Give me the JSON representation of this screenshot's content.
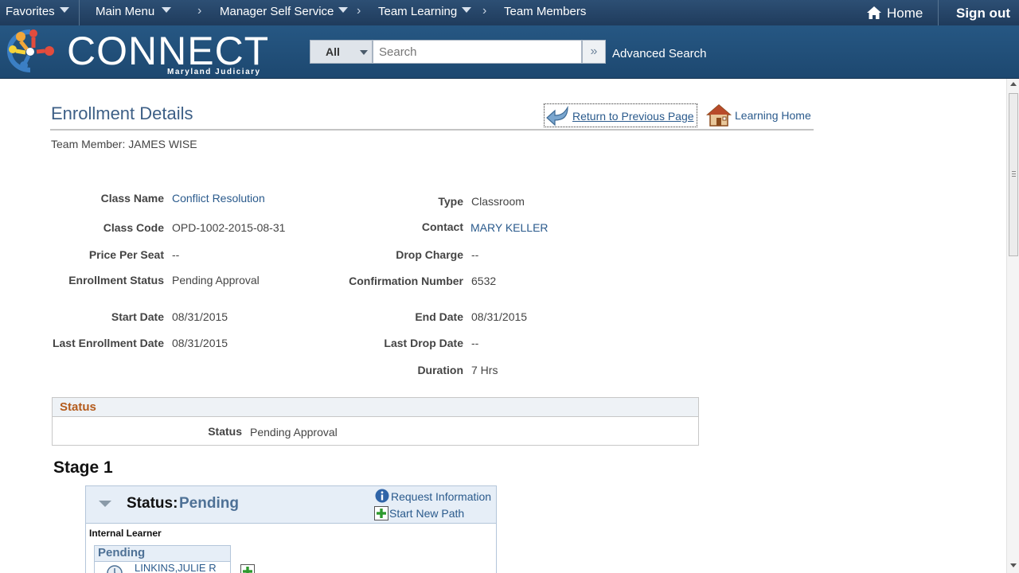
{
  "topnav": {
    "favorites": "Favorites",
    "main_menu": "Main Menu",
    "manager_self_service": "Manager Self Service",
    "team_learning": "Team Learning",
    "team_members": "Team Members",
    "home": "Home",
    "sign_out": "Sign out"
  },
  "banner": {
    "logo_text": "CONNECT",
    "logo_subtitle": "Maryland Judiciary",
    "search_scope": "All",
    "search_placeholder": "Search",
    "advanced_search": "Advanced Search"
  },
  "page": {
    "title": "Enrollment Details",
    "return_link": "Return to Previous Page",
    "learning_home_link": "Learning Home",
    "team_member": "Team Member: JAMES WISE"
  },
  "fields": {
    "class_name": {
      "label": "Class Name",
      "value": "Conflict Resolution"
    },
    "class_code": {
      "label": "Class Code",
      "value": "OPD-1002-2015-08-31"
    },
    "price_per_seat": {
      "label": "Price Per Seat",
      "value": "--"
    },
    "enrollment_status": {
      "label": "Enrollment Status",
      "value": "Pending Approval"
    },
    "start_date": {
      "label": "Start Date",
      "value": "08/31/2015"
    },
    "last_enrollment_date": {
      "label": "Last Enrollment Date",
      "value": "08/31/2015"
    },
    "type": {
      "label": "Type",
      "value": "Classroom"
    },
    "contact": {
      "label": "Contact",
      "value": "MARY KELLER"
    },
    "drop_charge": {
      "label": "Drop Charge",
      "value": "--"
    },
    "confirmation_number": {
      "label": "Confirmation Number",
      "value": "6532"
    },
    "end_date": {
      "label": "End Date",
      "value": "08/31/2015"
    },
    "last_drop_date": {
      "label": "Last Drop Date",
      "value": "--"
    },
    "duration": {
      "label": "Duration",
      "value": "7 Hrs"
    }
  },
  "status_section": {
    "header": "Status",
    "label": "Status",
    "value": "Pending Approval"
  },
  "stage": {
    "title": "Stage 1",
    "status_label": "Status:",
    "status_value": "Pending",
    "request_information": "Request Information",
    "start_new_path": "Start New Path",
    "internal_learner": "Internal Learner",
    "pending_header": "Pending",
    "approver": "LINKINS,JULIE R"
  },
  "colors": {
    "nav_bg": "#1f3b5c",
    "banner_bg": "#1d4870",
    "title": "#3d5f86",
    "link": "#2a5a8c",
    "status_header": "#b45b1c"
  }
}
